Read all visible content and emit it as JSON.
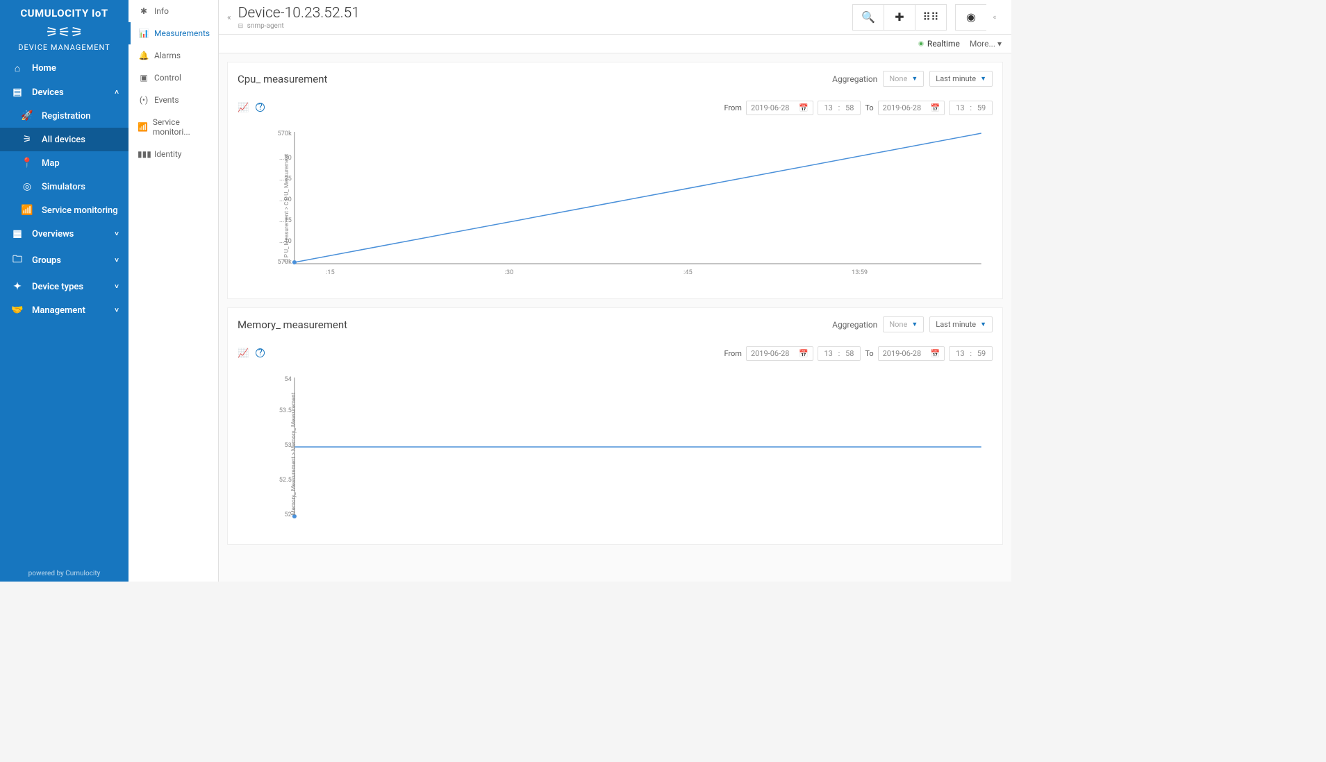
{
  "brand": {
    "title": "CUMULOCITY IoT",
    "subtitle": "DEVICE MANAGEMENT"
  },
  "sidebar": {
    "items": [
      {
        "label": "Home",
        "icon": "⌂"
      },
      {
        "label": "Devices",
        "icon": "▤",
        "expanded": true,
        "children": [
          {
            "label": "Registration",
            "icon": "🚀"
          },
          {
            "label": "All devices",
            "icon": "⚞",
            "active": true
          },
          {
            "label": "Map",
            "icon": "📍"
          },
          {
            "label": "Simulators",
            "icon": "◎"
          },
          {
            "label": "Service monitoring",
            "icon": "📶"
          }
        ]
      },
      {
        "label": "Overviews",
        "icon": "▦"
      },
      {
        "label": "Groups",
        "icon": "🗀"
      },
      {
        "label": "Device types",
        "icon": "✦"
      },
      {
        "label": "Management",
        "icon": "🤝"
      }
    ],
    "footer": "powered by Cumulocity"
  },
  "tabs": [
    {
      "label": "Info",
      "icon": "✱"
    },
    {
      "label": "Measurements",
      "icon": "📊",
      "active": true
    },
    {
      "label": "Alarms",
      "icon": "🔔"
    },
    {
      "label": "Control",
      "icon": "▣"
    },
    {
      "label": "Events",
      "icon": "(•)"
    },
    {
      "label": "Service monitori...",
      "icon": "📶"
    },
    {
      "label": "Identity",
      "icon": "▮▮▮"
    }
  ],
  "header": {
    "title": "Device-10.23.52.51",
    "breadcrumb": "snmp-agent"
  },
  "subbar": {
    "realtime": "Realtime",
    "more": "More... ▾"
  },
  "panels": [
    {
      "title": "Cpu_ measurement",
      "aggregation_label": "Aggregation",
      "aggregation_value": "None",
      "range_label": "Last minute",
      "from_label": "From",
      "to_label": "To",
      "from_date": "2019-06-28",
      "from_h": "13",
      "from_m": "58",
      "to_date": "2019-06-28",
      "to_h": "13",
      "to_m": "59",
      "ylabel": "C P U_ Measurement > C P U_ Measurement"
    },
    {
      "title": "Memory_ measurement",
      "aggregation_label": "Aggregation",
      "aggregation_value": "None",
      "range_label": "Last minute",
      "from_label": "From",
      "to_label": "To",
      "from_date": "2019-06-28",
      "from_h": "13",
      "from_m": "58",
      "to_date": "2019-06-28",
      "to_h": "13",
      "to_m": "59",
      "ylabel": "Memory_ Measurement > Memory_ Measurement"
    }
  ],
  "chart_data": [
    {
      "type": "line",
      "title": "Cpu_ measurement",
      "xlabel": "",
      "ylabel": "C P U_ Measurement > C P U_ Measurement",
      "x_ticks": [
        ":15",
        ":30",
        ":45",
        "13:59"
      ],
      "y_ticks": [
        "570k",
        "...10",
        "...15",
        "...20",
        "...25",
        "...30",
        "570k"
      ],
      "ylim": [
        570000,
        570035
      ],
      "series": [
        {
          "name": "CPU",
          "x": [
            0,
            60
          ],
          "values": [
            570000,
            570035
          ]
        }
      ]
    },
    {
      "type": "line",
      "title": "Memory_ measurement",
      "xlabel": "",
      "ylabel": "Memory_ Measurement > Memory_ Measurement",
      "x_ticks": [],
      "y_ticks": [
        "52",
        "52.5",
        "53",
        "53.5",
        "54"
      ],
      "ylim": [
        52,
        54
      ],
      "series": [
        {
          "name": "Memory",
          "x": [
            0,
            60
          ],
          "values": [
            53,
            53
          ]
        }
      ]
    }
  ]
}
